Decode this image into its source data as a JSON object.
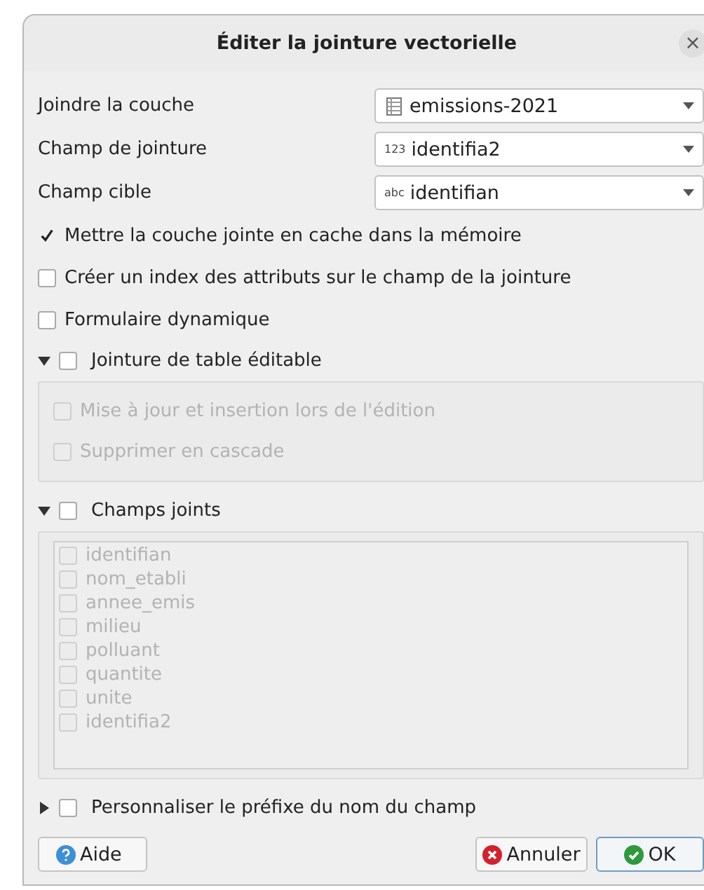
{
  "window": {
    "title": "Éditer la jointure vectorielle",
    "close": "×"
  },
  "fields": [
    {
      "label": "Joindre la couche",
      "kind": "layer",
      "value": "emissions-2021"
    },
    {
      "label": "Champ de jointure",
      "kind": "field",
      "type_label": "123",
      "value": "identifia2"
    },
    {
      "label": "Champ cible",
      "kind": "field",
      "type_label": "abc",
      "value": "identifian"
    }
  ],
  "options": [
    {
      "label": "Mettre la couche jointe en cache dans la mémoire",
      "checked": true
    },
    {
      "label": "Créer un index des attributs sur le champ de la jointure",
      "checked": false
    },
    {
      "label": "Formulaire dynamique",
      "checked": false
    }
  ],
  "groups": [
    {
      "label": "Jointure de table éditable",
      "expanded": true,
      "checked": false,
      "kind": "checks",
      "items": [
        {
          "label": "Mise à jour et insertion lors de l'édition",
          "checked": false,
          "disabled": true
        },
        {
          "label": "Supprimer en cascade",
          "checked": false,
          "disabled": true
        }
      ]
    },
    {
      "label": "Champs joints",
      "expanded": true,
      "checked": false,
      "kind": "list",
      "items": [
        {
          "label": "identifian",
          "checked": false,
          "disabled": true
        },
        {
          "label": "nom_etabli",
          "checked": false,
          "disabled": true
        },
        {
          "label": "annee_emis",
          "checked": false,
          "disabled": true
        },
        {
          "label": "milieu",
          "checked": false,
          "disabled": true
        },
        {
          "label": "polluant",
          "checked": false,
          "disabled": true
        },
        {
          "label": "quantite",
          "checked": false,
          "disabled": true
        },
        {
          "label": "unite",
          "checked": false,
          "disabled": true
        },
        {
          "label": "identifia2",
          "checked": false,
          "disabled": true
        }
      ]
    },
    {
      "label": "Personnaliser le préfixe du nom du champ",
      "expanded": false,
      "checked": false
    }
  ],
  "buttons": [
    {
      "label": "Aide",
      "kind": "help",
      "default": false
    },
    {
      "label": "Annuler",
      "kind": "cancel",
      "default": false
    },
    {
      "label": "OK",
      "kind": "ok",
      "default": true
    }
  ]
}
